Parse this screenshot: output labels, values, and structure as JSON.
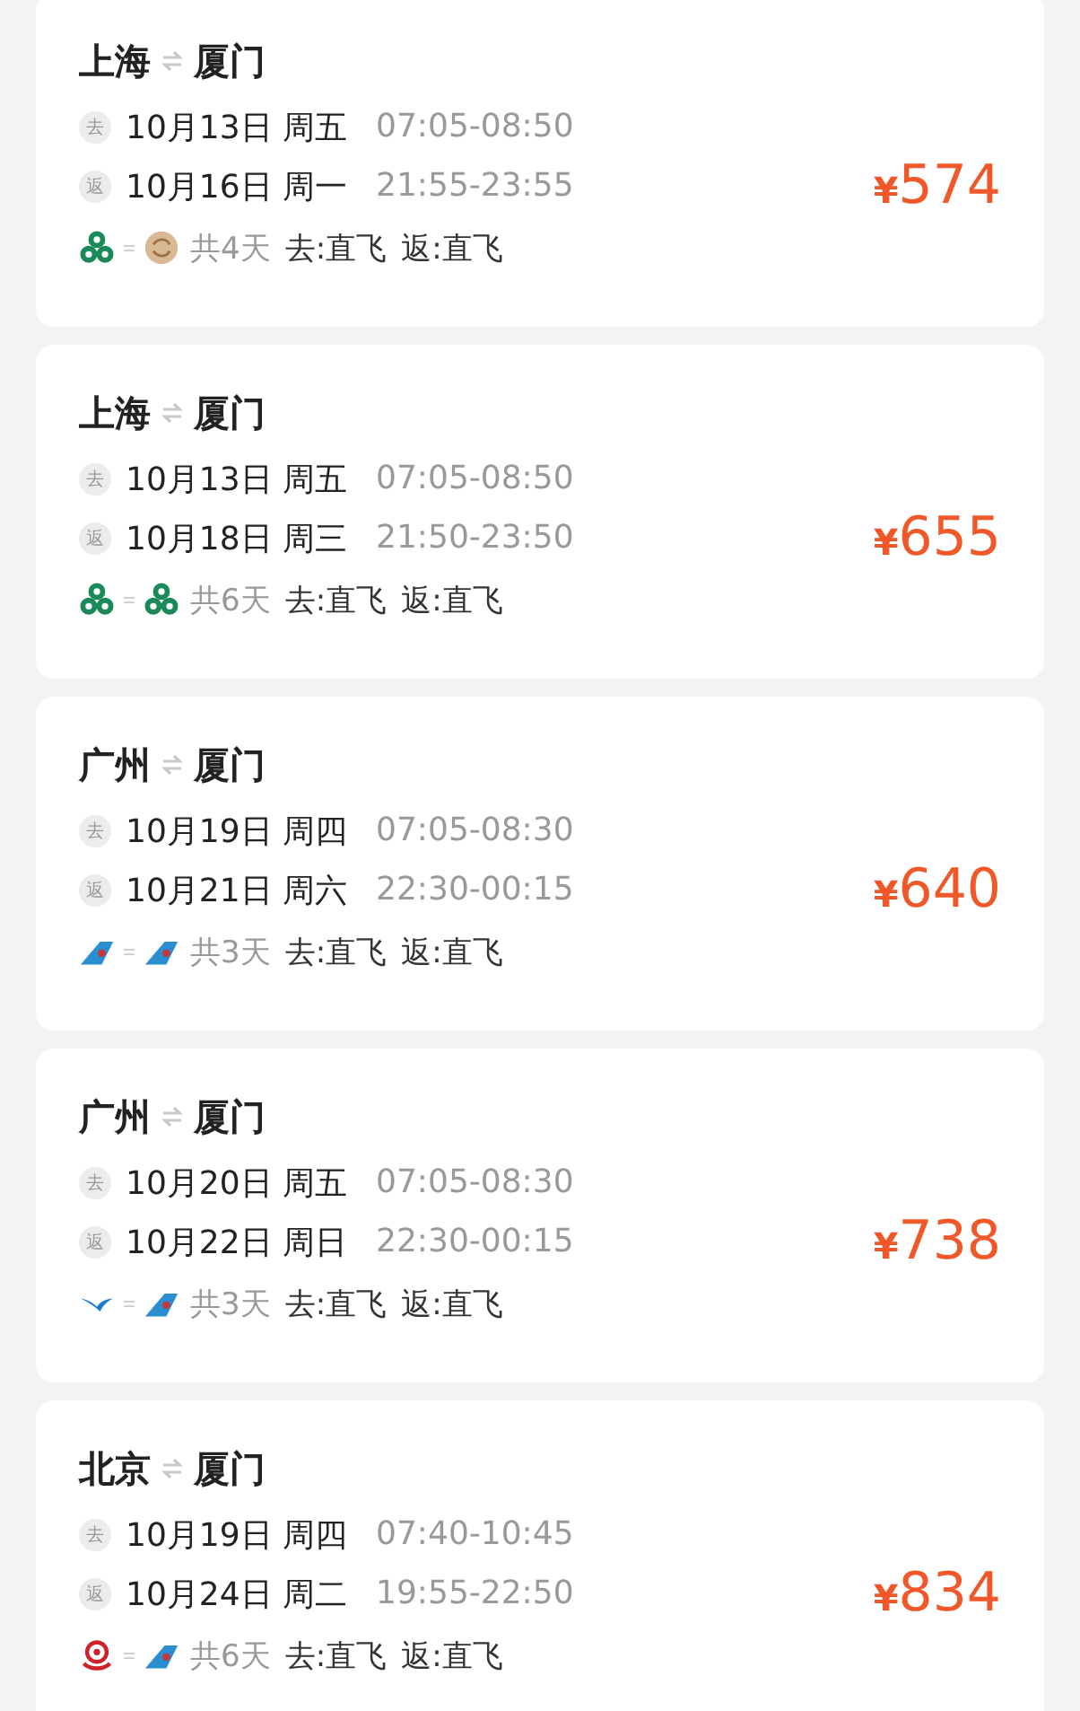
{
  "trips": [
    {
      "from": "上海",
      "to": "厦门",
      "legs": [
        {
          "badge": "去",
          "date": "10月13日 周五",
          "time": "07:05-08:50"
        },
        {
          "badge": "返",
          "date": "10月16日 周一",
          "time": "21:55-23:55"
        }
      ],
      "airlines": [
        {
          "kind": "clover"
        },
        {
          "kind": "medallion"
        }
      ],
      "duration": "共4天",
      "stops": [
        "去:直飞",
        "返:直飞"
      ],
      "currency": "¥",
      "price": "574"
    },
    {
      "from": "上海",
      "to": "厦门",
      "legs": [
        {
          "badge": "去",
          "date": "10月13日 周五",
          "time": "07:05-08:50"
        },
        {
          "badge": "返",
          "date": "10月18日 周三",
          "time": "21:50-23:50"
        }
      ],
      "airlines": [
        {
          "kind": "clover"
        },
        {
          "kind": "clover"
        }
      ],
      "duration": "共6天",
      "stops": [
        "去:直飞",
        "返:直飞"
      ],
      "currency": "¥",
      "price": "655"
    },
    {
      "from": "广州",
      "to": "厦门",
      "legs": [
        {
          "badge": "去",
          "date": "10月19日 周四",
          "time": "07:05-08:30"
        },
        {
          "badge": "返",
          "date": "10月21日 周六",
          "time": "22:30-00:15"
        }
      ],
      "airlines": [
        {
          "kind": "tail"
        },
        {
          "kind": "tail"
        }
      ],
      "duration": "共3天",
      "stops": [
        "去:直飞",
        "返:直飞"
      ],
      "currency": "¥",
      "price": "640"
    },
    {
      "from": "广州",
      "to": "厦门",
      "legs": [
        {
          "badge": "去",
          "date": "10月20日 周五",
          "time": "07:05-08:30"
        },
        {
          "badge": "返",
          "date": "10月22日 周日",
          "time": "22:30-00:15"
        }
      ],
      "airlines": [
        {
          "kind": "bird"
        },
        {
          "kind": "tail"
        }
      ],
      "duration": "共3天",
      "stops": [
        "去:直飞",
        "返:直飞"
      ],
      "currency": "¥",
      "price": "738"
    },
    {
      "from": "北京",
      "to": "厦门",
      "legs": [
        {
          "badge": "去",
          "date": "10月19日 周四",
          "time": "07:40-10:45"
        },
        {
          "badge": "返",
          "date": "10月24日 周二",
          "time": "19:55-22:50"
        }
      ],
      "airlines": [
        {
          "kind": "emblem"
        },
        {
          "kind": "tail"
        }
      ],
      "duration": "共6天",
      "stops": [
        "去:直飞",
        "返:直飞"
      ],
      "currency": "¥",
      "price": "834"
    }
  ]
}
